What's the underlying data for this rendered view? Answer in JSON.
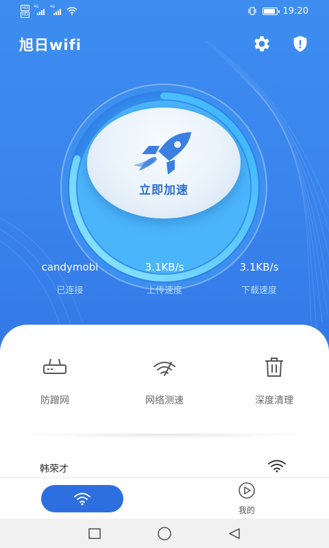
{
  "status_bar": {
    "hd_badges": [
      "HD",
      "HD"
    ],
    "net_type": [
      "4G",
      "4G"
    ],
    "time": "19:20",
    "battery_level": 0.9,
    "icons": [
      "vibrate-icon",
      "battery-icon",
      "wifi-icon"
    ]
  },
  "header": {
    "title": "旭日wifi",
    "settings_icon": "gear-icon",
    "security_icon": "shield-alert-icon"
  },
  "booster": {
    "label": "立即加速",
    "icon": "rocket-icon",
    "progress": 0.8
  },
  "stats": [
    {
      "value": "candymobi",
      "label": "已连接"
    },
    {
      "value": "3.1KB/s",
      "label": "上传速度"
    },
    {
      "value": "3.1KB/s",
      "label": "下载速度"
    }
  ],
  "tools": [
    {
      "label": "防蹭网",
      "icon": "router-icon"
    },
    {
      "label": "网络测速",
      "icon": "speedometer-icon"
    },
    {
      "label": "深度清理",
      "icon": "trash-icon"
    }
  ],
  "wifi_list": [
    {
      "name": "韩荣才",
      "icon": "wifi-signal-icon"
    }
  ],
  "tabbar": {
    "wifi_tab_icon": "wifi-icon",
    "mine_label": "我的",
    "mine_icon": "play-circle-icon"
  },
  "colors": {
    "primary": "#3a86ee",
    "tab_active": "#2e6fe0",
    "booster_text": "#2f6fcf",
    "stat_label": "#b7dcff"
  }
}
